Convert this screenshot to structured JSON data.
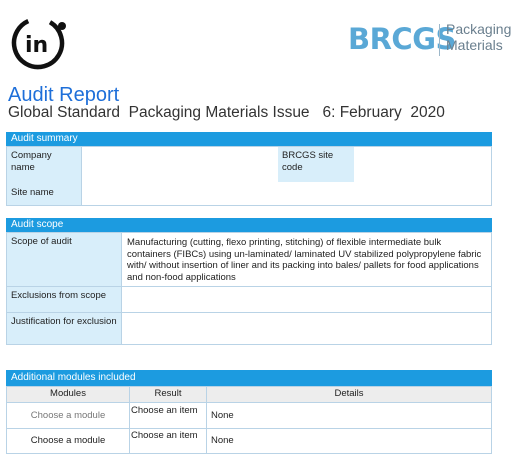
{
  "brand": {
    "logo_text": "in",
    "brcgs_word": "BRCGS",
    "brcgs_sub_line1": "Packaging",
    "brcgs_sub_line2": "Materials"
  },
  "title": "Audit Report",
  "subtitle": "Global Standard  Packaging Materials Issue   6: February  2020",
  "audit_summary": {
    "header": "Audit summary",
    "company_name_label": "Company name",
    "brcgs_site_code_label": "BRCGS site code",
    "site_name_label": "Site name",
    "company_name_value": "",
    "brcgs_site_code_value": "",
    "site_name_value": ""
  },
  "audit_scope": {
    "header": "Audit scope",
    "scope_label": "Scope of audit",
    "scope_value": "Manufacturing (cutting, flexo printing, stitching) of flexible intermediate bulk containers (FIBCs) using un-laminated/ laminated UV stabilized polypropylene fabric with/ without insertion of liner and its packing into bales/ pallets for food applications and non-food applications",
    "exclusions_label": "Exclusions from scope",
    "exclusions_value": "",
    "justification_label": "Justification for exclusion",
    "justification_value": ""
  },
  "additional_modules": {
    "header": "Additional modules included",
    "columns": [
      "Modules",
      "Result",
      "Details"
    ],
    "rows": [
      {
        "module": "Choose a module",
        "result": "Choose an item",
        "details": "None"
      },
      {
        "module": "Choose a module",
        "result": "Choose an item",
        "details": "None"
      }
    ]
  }
}
